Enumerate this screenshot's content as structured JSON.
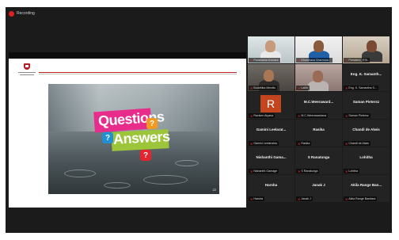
{
  "recording": {
    "label": "Recording",
    "icon": "record-dot-icon",
    "color": "#e02020"
  },
  "slide": {
    "questions_word": "Questions",
    "answers_word": "Answers",
    "bubble_glyph": "?",
    "page_number": "22"
  },
  "participants": [
    {
      "name": "Parakrama Kumara",
      "label": "Parakrama Kumara",
      "video": true,
      "active": true
    },
    {
      "name": "Dharshana Dharmarat",
      "label": "Dharshana Dharmara...",
      "video": true
    },
    {
      "name": "President_IESL",
      "label": "President_IESL",
      "video": true
    },
    {
      "name": "Buddhika Mendis",
      "label": "Buddhika Mendis",
      "video": true
    },
    {
      "name": "Lalith",
      "label": "Lalith",
      "video": true
    },
    {
      "name": "Eng. K. Samanth...",
      "label": "Eng. K. Samantha S...",
      "video": false
    },
    {
      "name": "Ravisen Aiyana",
      "label": "Ravisen Aiyana",
      "video": false,
      "avatar_letter": "R"
    },
    {
      "name": "M.C.Weeraward...",
      "label": "M.C.Weerawardana",
      "video": false
    },
    {
      "name": "Saman Pietersz",
      "label": "Saman Pietersz",
      "video": false
    },
    {
      "name": "Gamini Leelarat...",
      "label": "Gamini Leelaratna",
      "video": false
    },
    {
      "name": "Rasika",
      "label": "Rasika",
      "video": false
    },
    {
      "name": "Chandi de Alwis",
      "label": "Chandi de Alwis",
      "video": false
    },
    {
      "name": "Nishanthi Gama...",
      "label": "Nishanthi Gamage",
      "video": false
    },
    {
      "name": "S Ranatunga",
      "label": "S Ranatunga",
      "video": false
    },
    {
      "name": "Lohitha",
      "label": "Lohitha",
      "video": false
    },
    {
      "name": "Harsha",
      "label": "Harsha",
      "video": false
    },
    {
      "name": "Janak J",
      "label": "Janak J",
      "video": false
    },
    {
      "name": "Akila Range Ban...",
      "label": "Akila Range Bandara",
      "video": false
    }
  ],
  "colors": {
    "active_speaker_border": "#c7e532",
    "muted_icon": "#e02828",
    "tile_bg": "#232323",
    "window_bg": "#1b1b1b"
  }
}
